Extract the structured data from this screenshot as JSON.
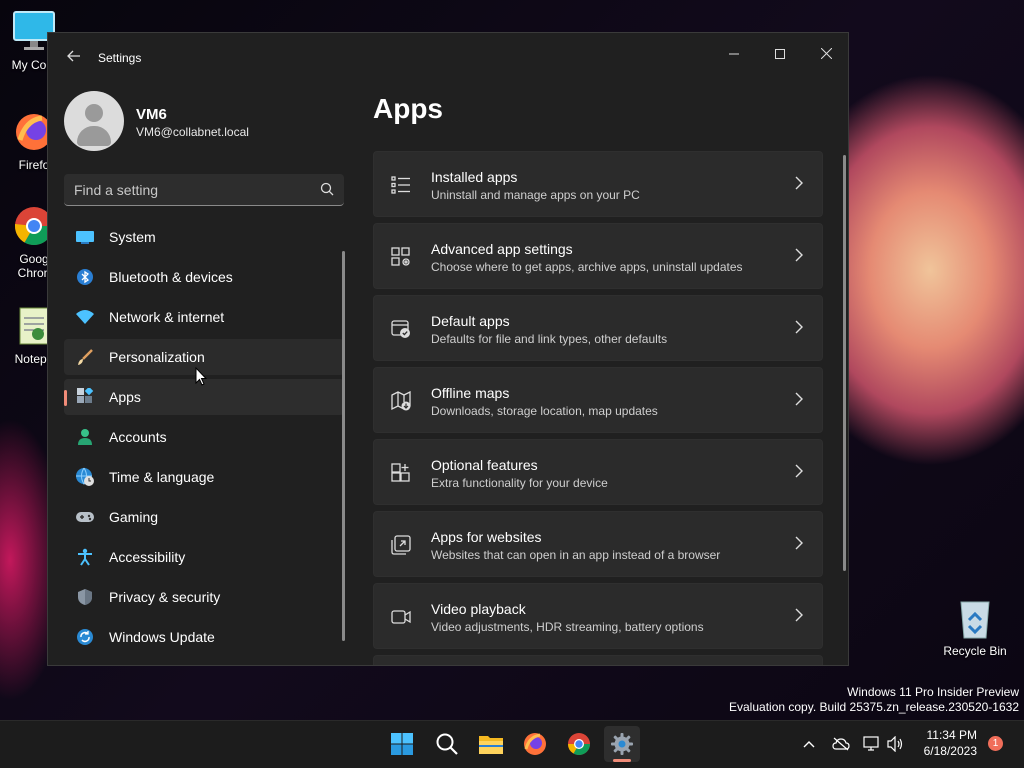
{
  "desktop": {
    "icons": [
      {
        "label": "My Com",
        "icon": "monitor-icon"
      },
      {
        "label": "Firefo",
        "icon": "firefox-icon"
      },
      {
        "label": "Goog Chron",
        "icon": "chrome-icon"
      },
      {
        "label": "Notepa",
        "icon": "notepad-icon"
      }
    ],
    "recycle_bin": {
      "label": "Recycle Bin",
      "icon": "recycle-bin-icon"
    },
    "watermark": {
      "line1": "Windows 11 Pro Insider Preview",
      "line2": "Evaluation copy. Build 25375.zn_release.230520-1632"
    }
  },
  "window": {
    "title": "Settings",
    "controls": {
      "minimize": "–",
      "maximize": "☐",
      "close": "✕"
    }
  },
  "user": {
    "name": "VM6",
    "email": "VM6@collabnet.local"
  },
  "search": {
    "placeholder": "Find a setting"
  },
  "nav": [
    {
      "label": "System",
      "icon": "system-icon",
      "state": ""
    },
    {
      "label": "Bluetooth & devices",
      "icon": "bluetooth-icon",
      "state": ""
    },
    {
      "label": "Network & internet",
      "icon": "wifi-icon",
      "state": ""
    },
    {
      "label": "Personalization",
      "icon": "brush-icon",
      "state": "hover"
    },
    {
      "label": "Apps",
      "icon": "apps-icon",
      "state": "active"
    },
    {
      "label": "Accounts",
      "icon": "person-icon",
      "state": ""
    },
    {
      "label": "Time & language",
      "icon": "globe-clock-icon",
      "state": ""
    },
    {
      "label": "Gaming",
      "icon": "gamepad-icon",
      "state": ""
    },
    {
      "label": "Accessibility",
      "icon": "accessibility-icon",
      "state": ""
    },
    {
      "label": "Privacy & security",
      "icon": "shield-icon",
      "state": ""
    },
    {
      "label": "Windows Update",
      "icon": "update-icon",
      "state": ""
    }
  ],
  "page": {
    "title": "Apps",
    "cards": [
      {
        "title": "Installed apps",
        "subtitle": "Uninstall and manage apps on your PC",
        "icon": "list-icon"
      },
      {
        "title": "Advanced app settings",
        "subtitle": "Choose where to get apps, archive apps, uninstall updates",
        "icon": "app-settings-icon"
      },
      {
        "title": "Default apps",
        "subtitle": "Defaults for file and link types, other defaults",
        "icon": "default-apps-icon"
      },
      {
        "title": "Offline maps",
        "subtitle": "Downloads, storage location, map updates",
        "icon": "map-icon"
      },
      {
        "title": "Optional features",
        "subtitle": "Extra functionality for your device",
        "icon": "optional-features-icon"
      },
      {
        "title": "Apps for websites",
        "subtitle": "Websites that can open in an app instead of a browser",
        "icon": "open-in-app-icon"
      },
      {
        "title": "Video playback",
        "subtitle": "Video adjustments, HDR streaming, battery options",
        "icon": "video-icon"
      }
    ]
  },
  "taskbar": {
    "apps": [
      "start-icon",
      "search-icon",
      "file-explorer-icon",
      "firefox-icon",
      "chrome-icon",
      "settings-icon"
    ],
    "clock": {
      "time": "11:34 PM",
      "date": "6/18/2023"
    },
    "notifications": "1"
  },
  "colors": {
    "accent": "#f08b78",
    "window_bg": "#202020",
    "card_bg": "#2b2b2b"
  }
}
